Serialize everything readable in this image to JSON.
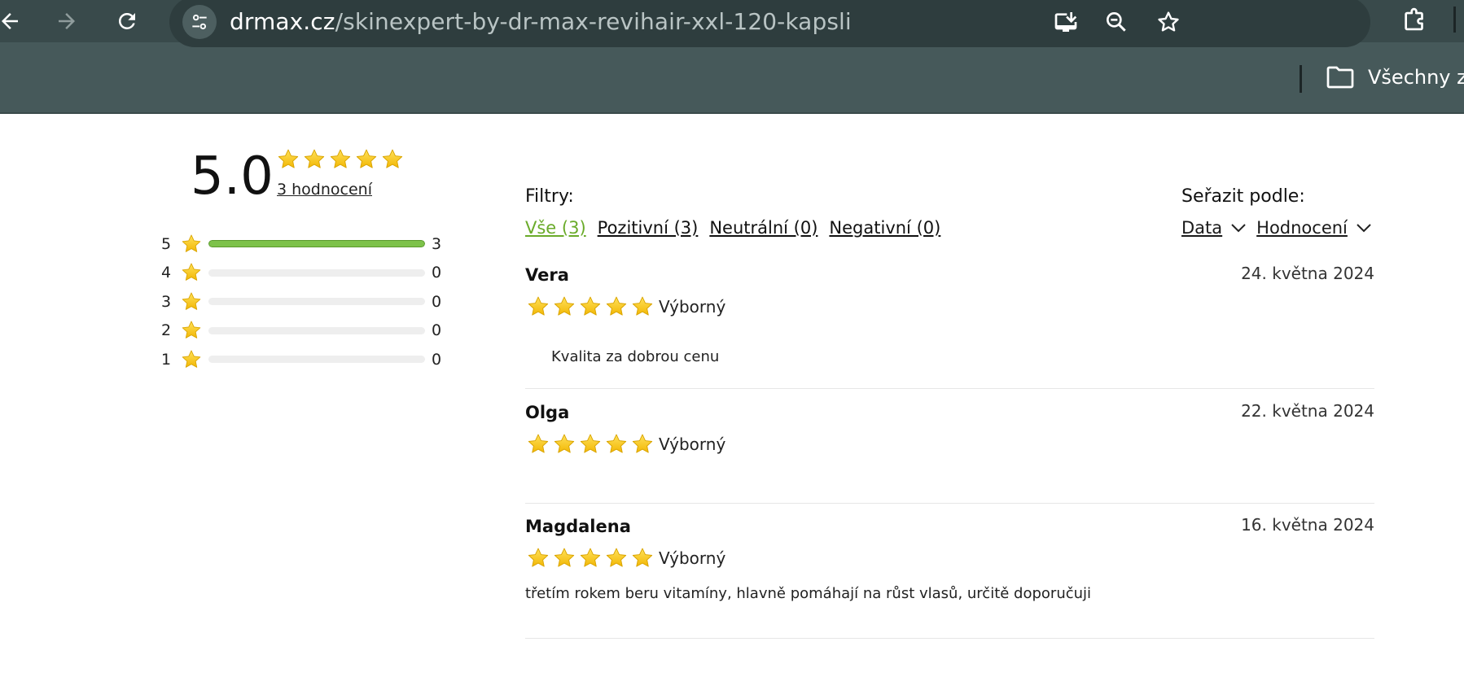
{
  "browser": {
    "url_host": "drmax.cz",
    "url_path": "/skinexpert-by-dr-max-revihair-xxl-120-kapsli",
    "bookmark_folder": "Všechny zá"
  },
  "colors": {
    "accent": "#6aab2a",
    "bar_fill": "#7dc24a",
    "star": "#f5c518",
    "chrome": "#46595a"
  },
  "summary": {
    "score": "5.0",
    "rating_fraction": 1.0,
    "count_label": "3 hodnocení"
  },
  "distribution": [
    {
      "stars": "5",
      "count": "3",
      "fraction": 1.0
    },
    {
      "stars": "4",
      "count": "0",
      "fraction": 0
    },
    {
      "stars": "3",
      "count": "0",
      "fraction": 0
    },
    {
      "stars": "2",
      "count": "0",
      "fraction": 0
    },
    {
      "stars": "1",
      "count": "0",
      "fraction": 0
    }
  ],
  "filters": {
    "label": "Filtry:",
    "items": [
      {
        "label": "Vše (3)",
        "active": true
      },
      {
        "label": "Pozitivní (3)",
        "active": false
      },
      {
        "label": "Neutrální (0)",
        "active": false
      },
      {
        "label": "Negativní (0)",
        "active": false
      }
    ]
  },
  "sort": {
    "label": "Seřazit podle:",
    "items": [
      {
        "label": "Data"
      },
      {
        "label": "Hodnocení"
      }
    ]
  },
  "reviews": [
    {
      "name": "Vera",
      "date": "24. května 2024",
      "rating": 5,
      "verdict": "Výborný",
      "text": "Kvalita za dobrou cenu"
    },
    {
      "name": "Olga",
      "date": "22. května 2024",
      "rating": 5,
      "verdict": "Výborný",
      "text": ""
    },
    {
      "name": "Magdalena",
      "date": "16. května 2024",
      "rating": 5,
      "verdict": "Výborný",
      "text": "třetím rokem beru vitamíny, hlavně pomáhají na růst vlasů, určitě doporučuji"
    }
  ]
}
